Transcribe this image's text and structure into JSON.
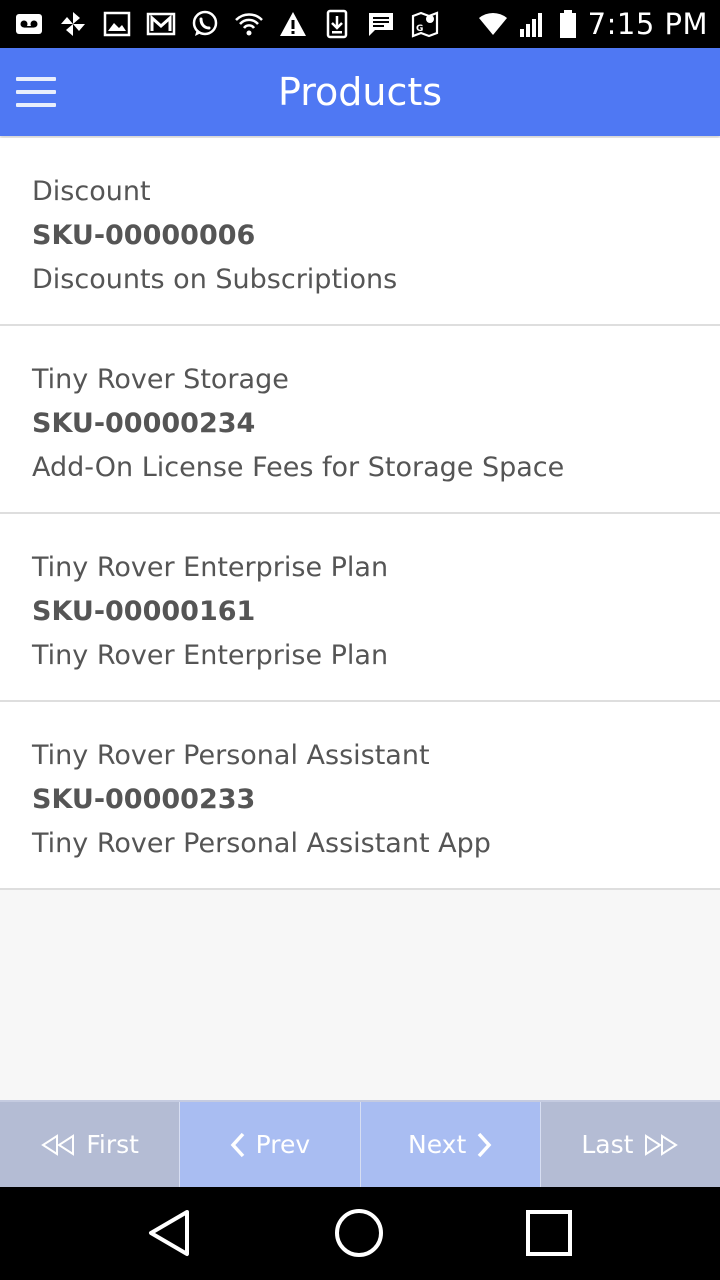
{
  "status_bar": {
    "time": "7:15 PM",
    "icons": [
      "voicemail-icon",
      "pinwheel-icon",
      "image-icon",
      "gmail-icon",
      "whatsapp-icon",
      "wifi-outline-icon",
      "warning-icon",
      "download-icon",
      "message-icon",
      "maps-icon",
      "wifi-signal-icon",
      "cell-signal-icon",
      "battery-icon"
    ]
  },
  "app_bar": {
    "title": "Products",
    "menu_icon": "hamburger-menu-icon",
    "color": "#4f78f3"
  },
  "products": [
    {
      "name": "Discount",
      "sku": "SKU-00000006",
      "description": "Discounts on Subscriptions"
    },
    {
      "name": "Tiny Rover Storage",
      "sku": "SKU-00000234",
      "description": "Add-On License Fees for Storage Space"
    },
    {
      "name": "Tiny Rover Enterprise Plan",
      "sku": "SKU-00000161",
      "description": "Tiny Rover Enterprise Plan"
    },
    {
      "name": "Tiny Rover Personal Assistant",
      "sku": "SKU-00000233",
      "description": "Tiny Rover Personal Assistant App"
    }
  ],
  "pager": {
    "first_label": "First",
    "prev_label": "Prev",
    "next_label": "Next",
    "last_label": "Last",
    "disabled_color": "#b4bcd4",
    "active_color": "#a9bdf2"
  },
  "nav_bar": {
    "icons": [
      "back-triangle-icon",
      "home-circle-icon",
      "recents-square-icon"
    ]
  }
}
